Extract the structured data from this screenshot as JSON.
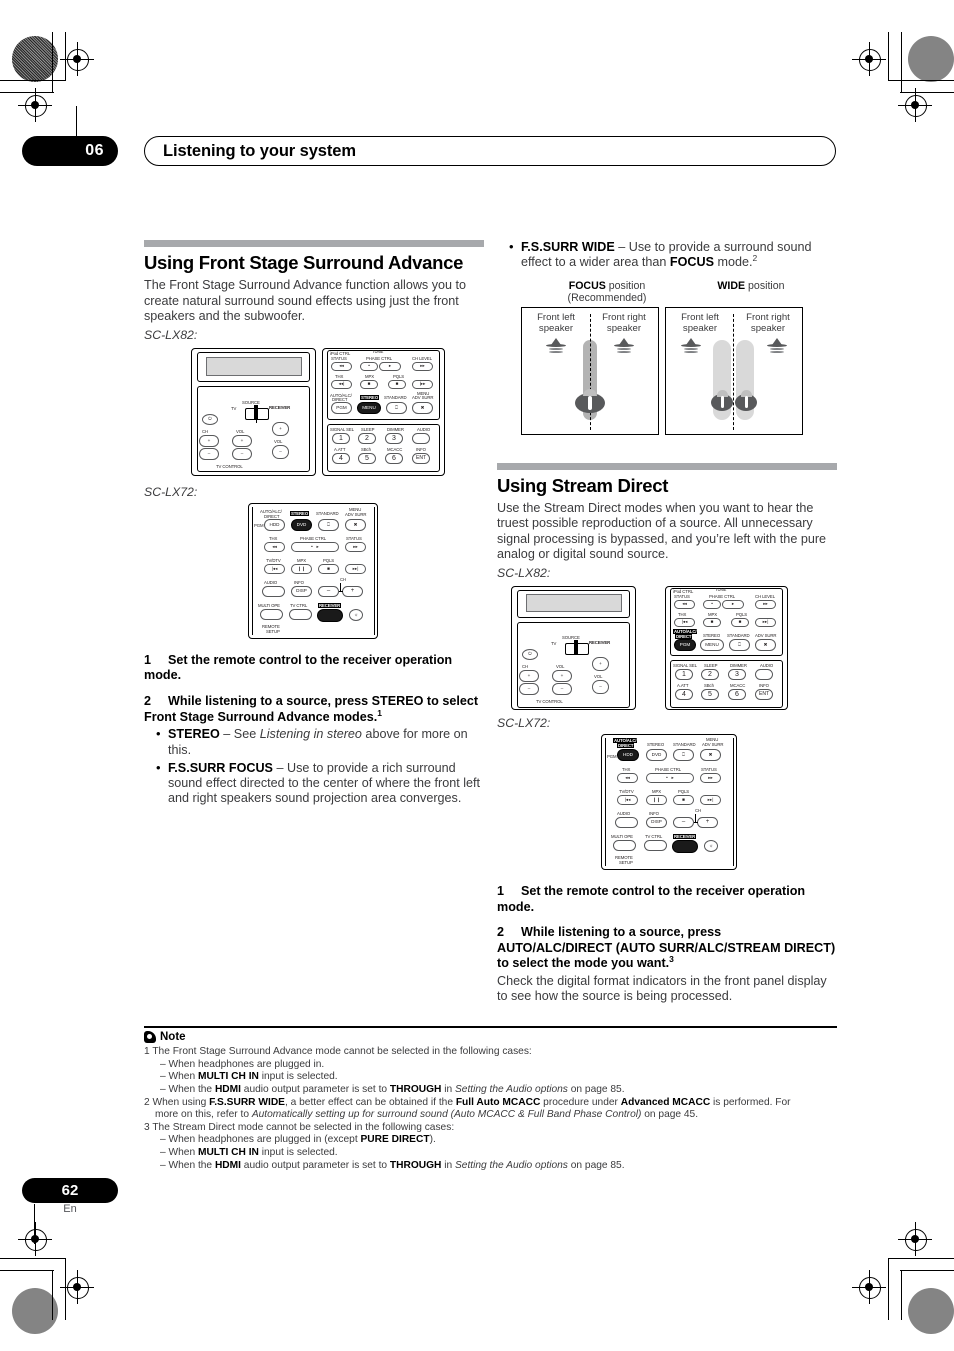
{
  "header": {
    "chapter_number": "06",
    "title": "Listening to your system"
  },
  "footer": {
    "page_number": "62",
    "language": "En"
  },
  "left_column": {
    "section_title": "Using Front Stage Surround Advance",
    "intro": "The Front Stage Surround Advance function allows you to create natural surround sound effects using just the front speakers and the subwoofer.",
    "model_1": "SC-LX82:",
    "model_2": "SC-LX72:",
    "step1_num": "1",
    "step1_text": "Set the remote control to the receiver operation mode.",
    "step2_num": "2",
    "step2_text_a": "While listening to a source, press STEREO to select Front Stage Surround Advance modes.",
    "step2_footnote": "1",
    "bullets": [
      {
        "term": "STEREO",
        "dash": " – See ",
        "italic": "Listening in stereo",
        "rest": " above for more on this."
      },
      {
        "term": "F.S.SURR FOCUS",
        "dash": " – Use to provide a rich surround sound effect directed to the center of where the front left and right speakers sound projection area converges.",
        "italic": "",
        "rest": ""
      }
    ]
  },
  "right_column": {
    "wide_bullet": {
      "term": "F.S.SURR WIDE",
      "text_a": " – Use to provide a surround sound effect to a wider area than ",
      "term2": "FOCUS",
      "text_b": " mode.",
      "footnote": "2"
    },
    "figure": {
      "focus_caption_bold": "FOCUS",
      "focus_caption_rest": " position",
      "focus_caption_line2": "(Recommended)",
      "wide_caption_bold": "WIDE",
      "wide_caption_rest": " position",
      "front_left": "Front left\nspeaker",
      "front_right": "Front right\nspeaker"
    },
    "section_title": "Using Stream Direct",
    "intro": "Use the Stream Direct modes when you want to hear the truest possible reproduction of a source. All unnecessary signal processing is bypassed, and you’re left with the pure analog or digital sound source.",
    "model_1": "SC-LX82:",
    "model_2": "SC-LX72:",
    "step1_num": "1",
    "step1_text": "Set the remote control to the receiver operation mode.",
    "step2_num": "2",
    "step2_text": "While listening to a source, press AUTO/ALC/DIRECT (AUTO SURR/ALC/STREAM DIRECT) to select the mode you want.",
    "step2_footnote": "3",
    "step2_follow": "Check the digital format indicators in the front panel display to see how the source is being processed."
  },
  "note": {
    "heading": "Note",
    "items": [
      {
        "id": "1",
        "text": "The Front Stage Surround Advance mode cannot be selected in the following cases:"
      },
      {
        "id": "",
        "dash": "– ",
        "text": "When headphones are plugged in."
      },
      {
        "id": "",
        "dash": "– ",
        "text": "When MULTI CH IN input is selected."
      },
      {
        "id": "",
        "dash": "– ",
        "text": "When the HDMI audio output parameter is set to THROUGH in Setting the Audio options on page 85."
      },
      {
        "id": "2",
        "text": "When using F.S.SURR WIDE, a better effect can be obtained if the Full Auto MCACC procedure under Advanced MCACC is performed. For more on this, refer to Automatically setting up for surround sound (Auto MCACC & Full Band Phase Control) on page 45."
      },
      {
        "id": "3",
        "text": "The Stream Direct mode cannot be selected in the following cases:"
      },
      {
        "id": "",
        "dash": "– ",
        "text": "When headphones are plugged in (except PURE DIRECT)."
      },
      {
        "id": "",
        "dash": "– ",
        "text": "When MULTI CH IN input is selected."
      },
      {
        "id": "",
        "dash": "– ",
        "text": "When the HDMI audio output parameter is set to THROUGH in Setting the Audio options on page 85."
      }
    ]
  },
  "remote_lx82": {
    "labels": {
      "tv": "TV",
      "source": "SOURCE",
      "receiver": "RECEIVER",
      "ch": "CH",
      "vol": "VOL",
      "vol_side": "VOL",
      "tv_control": "TV CONTROL",
      "ipod_ctrl": "iPod CTRL",
      "tune": "TUNE",
      "status": "STATUS",
      "phase_ctrl": "PHASE CTRL",
      "ch_level": "CH LEVEL",
      "thx": "THX",
      "mpx": "MPX",
      "pqls": "PQLS",
      "auto_alc": "AUTO/ALC/",
      "direct": "DIRECT",
      "stereo": "STEREO",
      "standard": "STANDARD",
      "menu_adv": "MENU",
      "adv_surr": "ADV SURR",
      "signal_sel": "SIGNAL SEL",
      "sleep": "SLEEP",
      "dimmer": "DIMMER",
      "audio": "AUDIO",
      "aatt": "A.ATT",
      "sbch": "SBch",
      "mcacc": "MCACC",
      "info": "INFO"
    },
    "buttons": {
      "pgm": "PGM",
      "menu": "MENU",
      "one": "1",
      "two": "2",
      "three": "3",
      "four": "4",
      "five": "5",
      "six": "6",
      "seven": "ENT"
    }
  },
  "remote_lx72": {
    "labels": {
      "auto_alc": "AUTO/ALC/",
      "direct": "DIRECT",
      "stereo": "STEREO",
      "standard": "STANDARD",
      "menu": "MENU",
      "adv_surr": "ADV SURR",
      "pgm": "PGM",
      "thx": "THX",
      "phase_ctrl": "PHASE CTRL",
      "status": "STATUS",
      "tv_dtv": "TV/DTV",
      "mpx": "MPX",
      "pqls": "PQLS",
      "audio": "AUDIO",
      "info": "INFO",
      "ch": "CH",
      "multi_ope": "MULTI OPE",
      "tv_ctrl": "TV CTRL",
      "receiver": "RECEIVER",
      "remote": "REMOTE",
      "setup": "SETUP"
    },
    "buttons": {
      "hdd": "HDD",
      "dvd": "DVD",
      "disp": "DISP",
      "minus": "–",
      "plus": "+"
    }
  }
}
